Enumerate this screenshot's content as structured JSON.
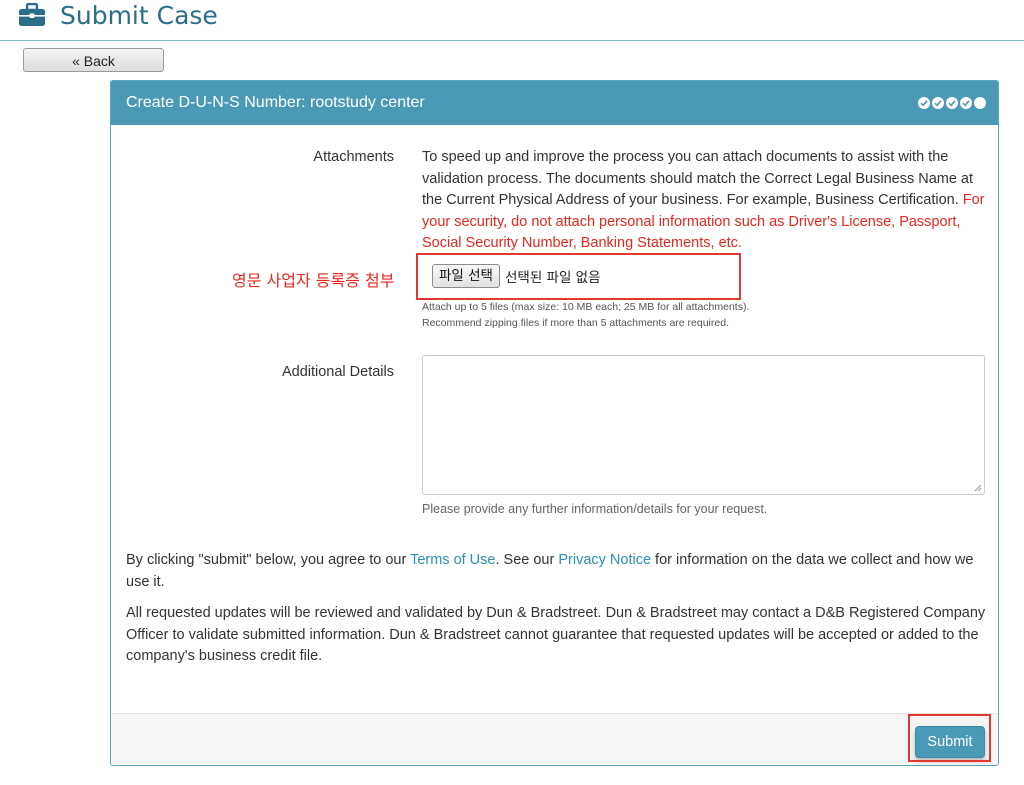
{
  "header": {
    "title": "Submit Case",
    "icon": "briefcase-icon"
  },
  "nav": {
    "back_label": "« Back"
  },
  "panel": {
    "title": "Create D-U-N-S Number: rootstudy center",
    "progress": {
      "total": 5,
      "completed": 4
    }
  },
  "attachments": {
    "label": "Attachments",
    "description": "To speed up and improve the process you can attach documents to assist with the validation process. The documents should match the Correct Legal Business Name at the Current Physical Address of your business. For example, Business Certification.",
    "warning": "For your security, do not attach personal information such as Driver's License, Passport, Social Security Number, Banking Statements, etc.",
    "file_button": "파일 선택",
    "file_status": "선택된 파일 없음",
    "limit_note": "Attach up to 5 files (max size: 10 MB each; 25 MB for all attachments).",
    "zip_note": "Recommend zipping files if more than 5 attachments are required."
  },
  "annotation": {
    "text": "영문 사업자 등록증 첨부",
    "color": "#e8281e"
  },
  "details": {
    "label": "Additional Details",
    "value": "",
    "help": "Please provide any further information/details for your request."
  },
  "legal": {
    "p1_before": "By clicking \"submit\" below, you agree to our ",
    "terms_link": "Terms of Use",
    "p1_middle": ". See our ",
    "privacy_link": "Privacy Notice",
    "p1_after": " for information on the data we collect and how we use it.",
    "p2": "All requested updates will be reviewed and validated by Dun & Bradstreet. Dun & Bradstreet may contact a D&B Registered Company Officer to validate submitted information. Dun & Bradstreet cannot guarantee that requested updates will be accepted or added to the company's business credit file."
  },
  "footer": {
    "submit_label": "Submit"
  },
  "colors": {
    "accent": "#4a9ab7",
    "link": "#2d8fb5",
    "warning": "#e8281e",
    "title": "#2a6e8a"
  }
}
